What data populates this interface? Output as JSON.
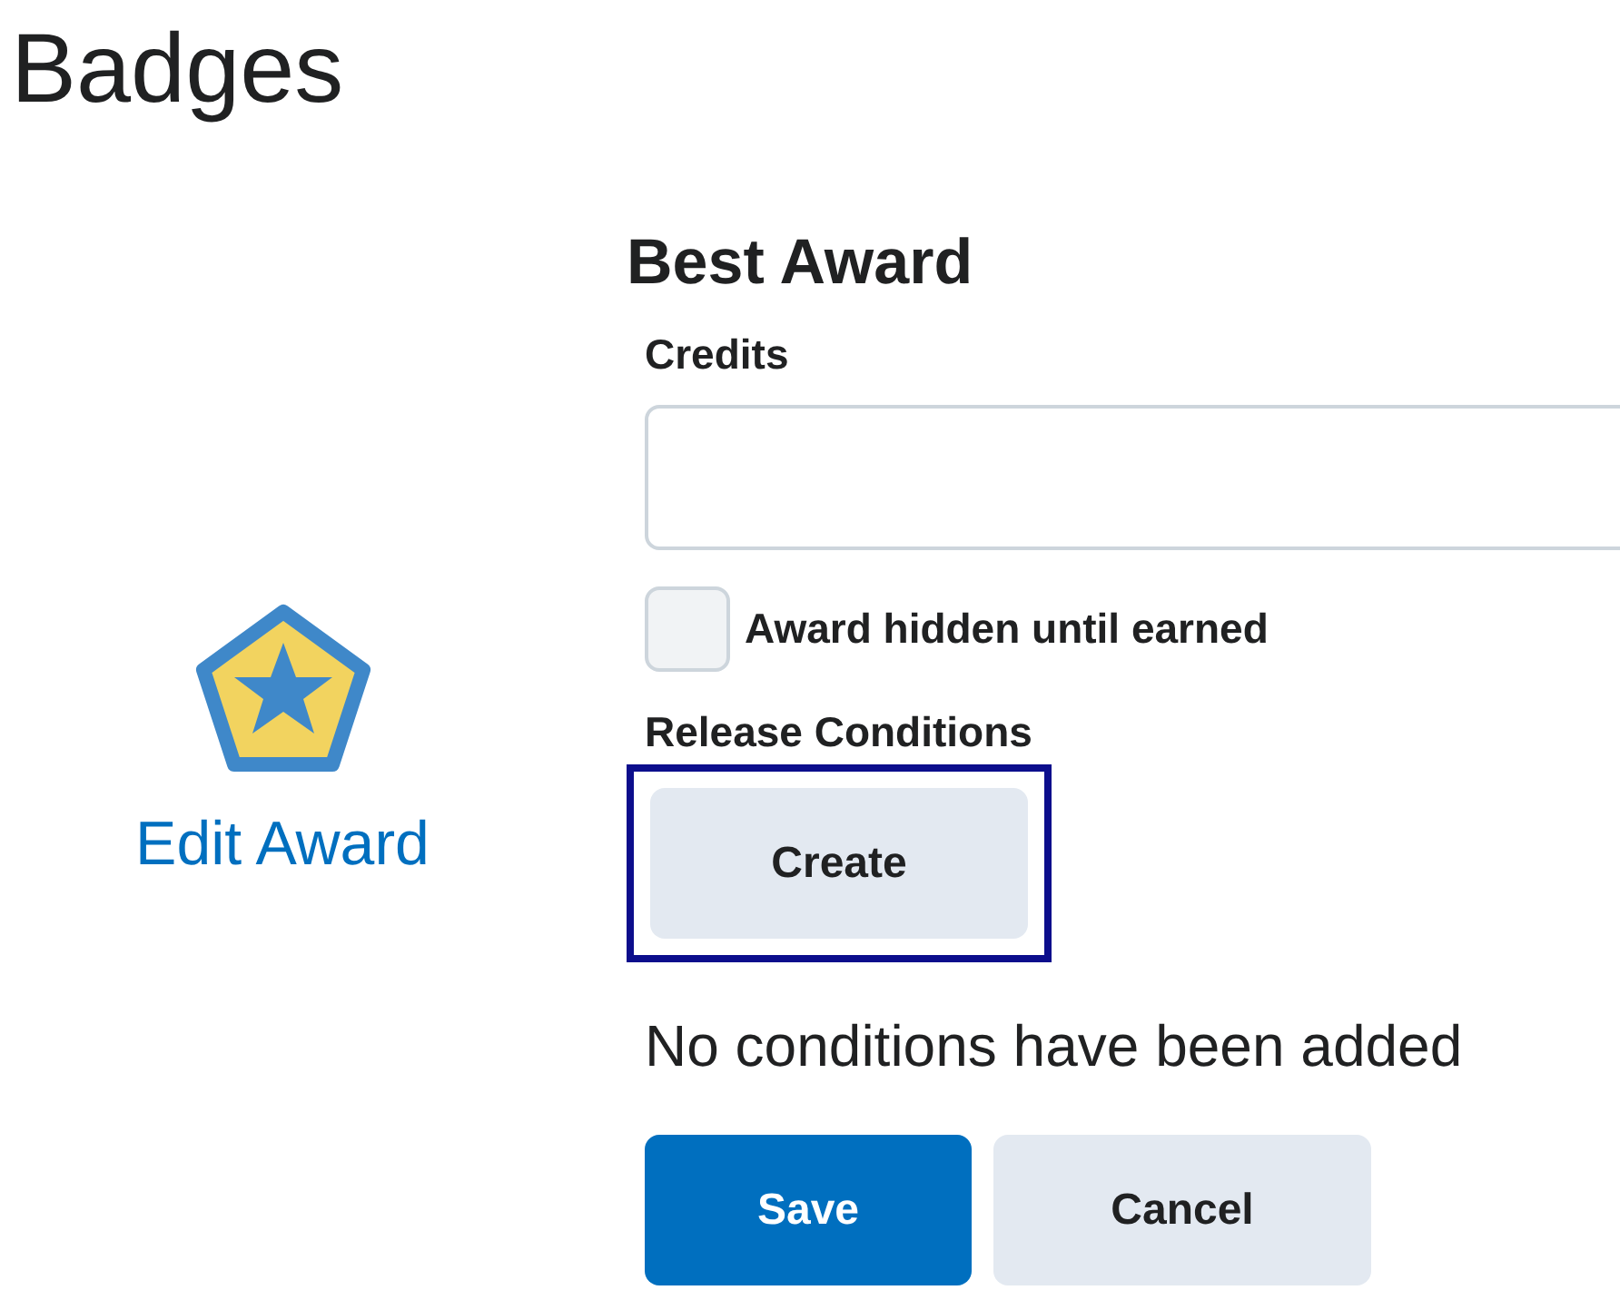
{
  "page_title": "Badges",
  "badge": {
    "link": "Edit Award"
  },
  "form": {
    "title": "Best Award",
    "credits": {
      "label": "Credits"
    },
    "hidden_checkbox": {
      "label": "Award hidden until earned",
      "checked": false
    },
    "release_conditions": {
      "label": "Release Conditions",
      "create_button": {
        "label": "Create",
        "focused": true
      },
      "empty_message": "No conditions have been added"
    },
    "buttons": [
      {
        "label": "Save",
        "kind": "primary"
      },
      {
        "label": "Cancel",
        "kind": "secondary"
      }
    ]
  }
}
